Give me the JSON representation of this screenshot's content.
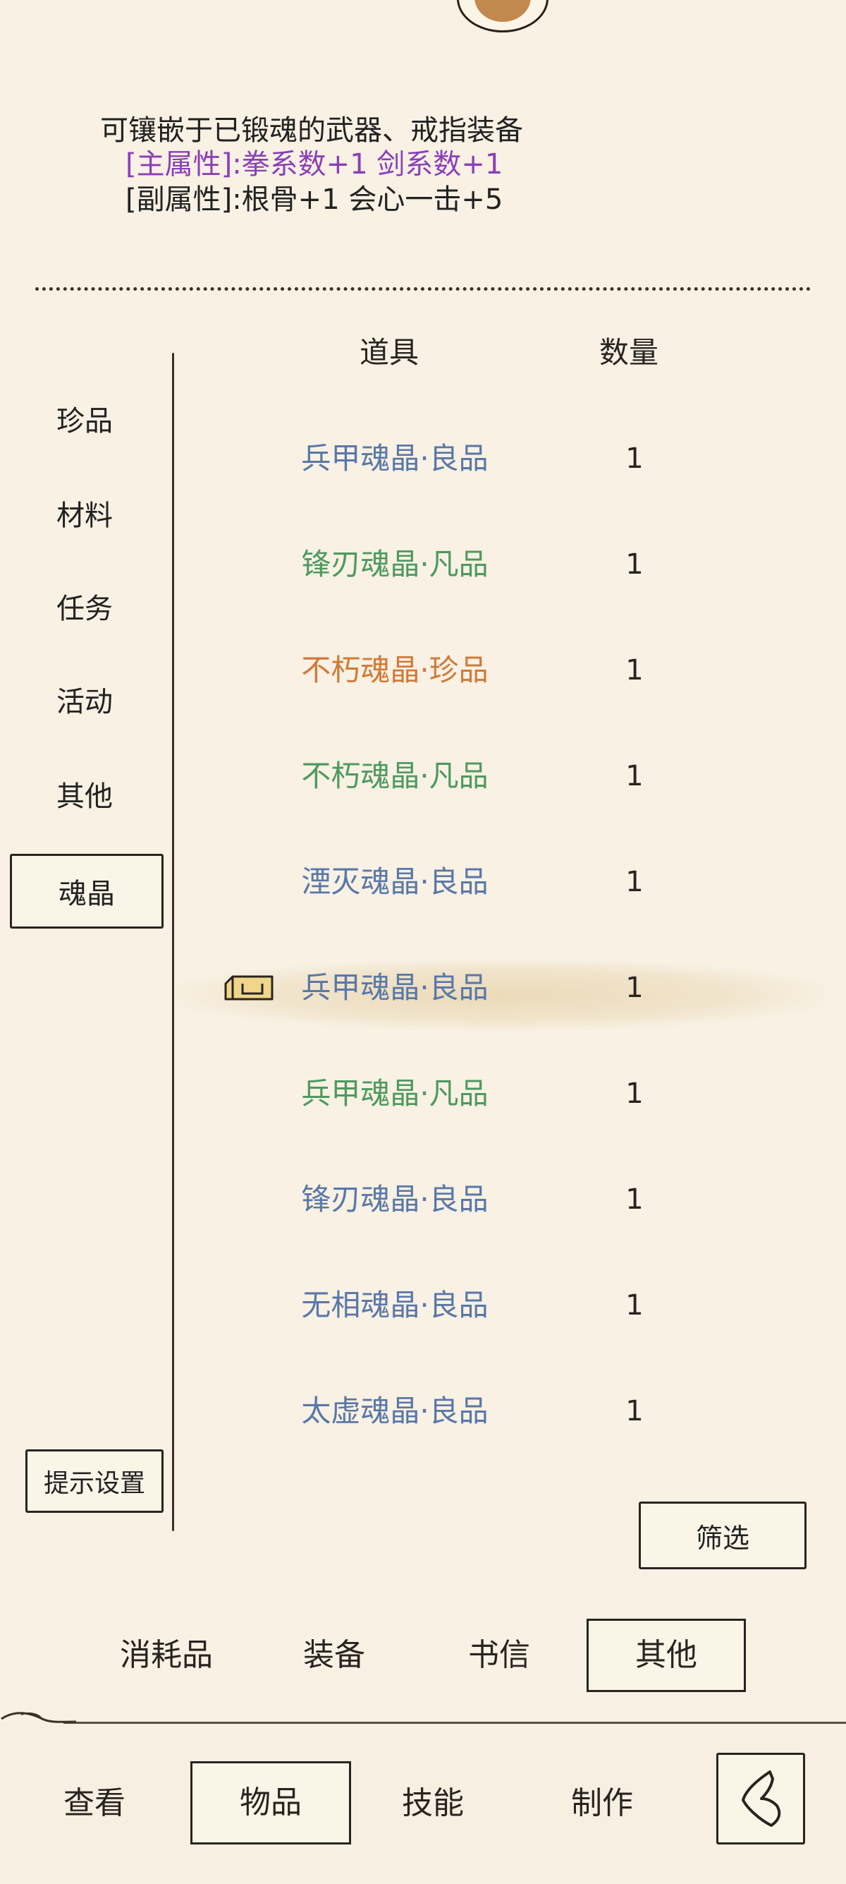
{
  "description": {
    "line1": "可镶嵌于已锻魂的武器、戒指装备",
    "main_attr": "[主属性]:拳系数+1 剑系数+1",
    "sub_attr": "[副属性]:根骨+1 会心一击+5"
  },
  "table": {
    "col_item": "道具",
    "col_qty": "数量"
  },
  "categories": [
    {
      "label": "珍品"
    },
    {
      "label": "材料"
    },
    {
      "label": "任务"
    },
    {
      "label": "活动"
    },
    {
      "label": "其他"
    },
    {
      "label": "魂晶",
      "selected": true
    }
  ],
  "items": [
    {
      "name": "兵甲魂晶·良品",
      "qty": "1",
      "color": "#5a78a8"
    },
    {
      "name": "锋刃魂晶·凡品",
      "qty": "1",
      "color": "#4e9a5e"
    },
    {
      "name": "不朽魂晶·珍品",
      "qty": "1",
      "color": "#d07a38"
    },
    {
      "name": "不朽魂晶·凡品",
      "qty": "1",
      "color": "#4e9a5e"
    },
    {
      "name": "湮灭魂晶·良品",
      "qty": "1",
      "color": "#5a78a8"
    },
    {
      "name": "兵甲魂晶·良品",
      "qty": "1",
      "color": "#5a78a8",
      "equipped": true
    },
    {
      "name": "兵甲魂晶·凡品",
      "qty": "1",
      "color": "#4e9a5e"
    },
    {
      "name": "锋刃魂晶·良品",
      "qty": "1",
      "color": "#5a78a8"
    },
    {
      "name": "无相魂晶·良品",
      "qty": "1",
      "color": "#5a78a8"
    },
    {
      "name": "太虚魂晶·良品",
      "qty": "1",
      "color": "#5a78a8"
    }
  ],
  "buttons": {
    "hint_settings": "提示设置",
    "filter": "筛选"
  },
  "inventory_tabs": [
    {
      "label": "消耗品"
    },
    {
      "label": "装备"
    },
    {
      "label": "书信"
    },
    {
      "label": "其他",
      "selected": true
    }
  ],
  "bottom_nav": [
    {
      "label": "查看"
    },
    {
      "label": "物品",
      "selected": true
    },
    {
      "label": "技能"
    },
    {
      "label": "制作"
    }
  ],
  "icons": {
    "avatar": "character-avatar",
    "equipped": "equipped-box-icon",
    "back": "back-arrow-icon"
  }
}
